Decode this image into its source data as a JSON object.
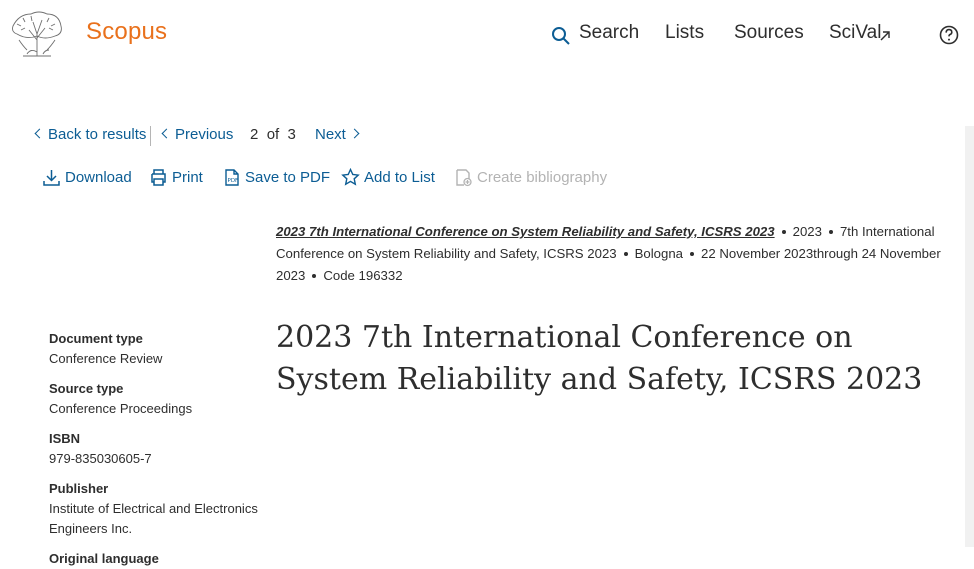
{
  "header": {
    "brand": "Scopus",
    "nav": {
      "search": "Search",
      "lists": "Lists",
      "sources": "Sources",
      "scival": "SciVal"
    },
    "icons": [
      "elsevier-tree-logo",
      "search-icon",
      "external-link-icon",
      "help-icon"
    ]
  },
  "pager": {
    "back": "Back to results",
    "previous": "Previous",
    "current": "2",
    "of": "of",
    "total": "3",
    "next": "Next"
  },
  "toolbar": {
    "download": "Download",
    "print": "Print",
    "save_pdf": "Save to PDF",
    "add_list": "Add to List",
    "create_bib": "Create bibliography"
  },
  "source": {
    "title": "2023 7th International Conference on System Reliability and Safety, ICSRS 2023",
    "year": "2023",
    "conference": "7th International Conference on System Reliability and Safety, ICSRS 2023",
    "location": "Bologna",
    "dates": "22 November 2023through 24 November 2023",
    "code": "Code 196332"
  },
  "document": {
    "title": "2023 7th International Conference on System Reliability and Safety, ICSRS 2023"
  },
  "meta": [
    {
      "label": "Document type",
      "value": "Conference Review"
    },
    {
      "label": "Source type",
      "value": "Conference Proceedings"
    },
    {
      "label": "ISBN",
      "value": "979-835030605-7"
    },
    {
      "label": "Publisher",
      "value": "Institute of Electrical and Electronics Engineers Inc."
    },
    {
      "label": "Original language",
      "value": ""
    }
  ],
  "colors": {
    "brand": "#e9711c",
    "link": "#0c5d94",
    "text": "#2e2e2e",
    "disabled": "#b3b3b3"
  }
}
